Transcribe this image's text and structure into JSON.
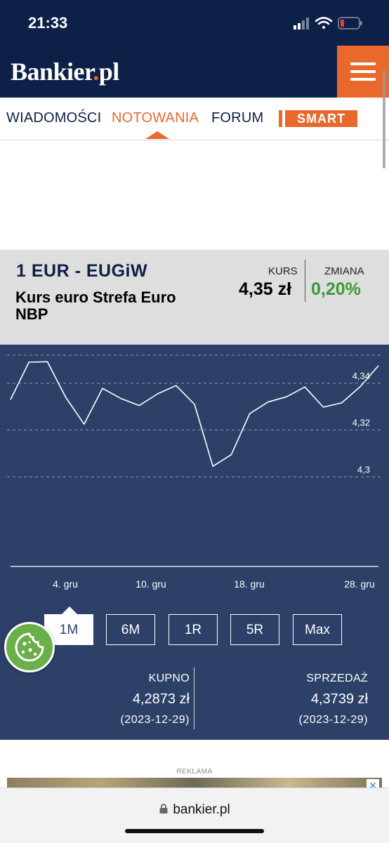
{
  "status": {
    "time": "21:33"
  },
  "header": {
    "logo_main": "Bankier",
    "logo_dot": ".",
    "logo_tld": "pl"
  },
  "nav": {
    "items": [
      "WIADOMOŚCI",
      "NOTOWANIA",
      "FORUM"
    ],
    "smart_label": "SMART"
  },
  "quote": {
    "pair": "1 EUR - EUGiW",
    "description": "Kurs euro Strefa Euro NBP",
    "kurs_label": "KURS",
    "kurs_value": "4,35 zł",
    "zmiana_label": "ZMIANA",
    "zmiana_value": "0,20%"
  },
  "colors": {
    "navy": "#0d2048",
    "accent": "#e9692c",
    "chart_bg": "#2c4068",
    "positive": "#3a9a3a"
  },
  "chart_data": {
    "type": "line",
    "y_ticks": [
      "4,34",
      "4,32",
      "4,3"
    ],
    "x_ticks": [
      "4. gru",
      "10. gru",
      "18. gru",
      "28. gru"
    ],
    "ylim": [
      4.28,
      4.352
    ],
    "series": [
      {
        "values": [
          4.333,
          4.349,
          4.3492,
          4.334,
          4.3225,
          4.3378,
          4.3335,
          4.3305,
          4.3355,
          4.339,
          4.331,
          4.3045,
          4.3095,
          4.327,
          4.332,
          4.3342,
          4.3384,
          4.3298,
          4.3316,
          4.3385,
          4.3475
        ]
      }
    ],
    "grid": true
  },
  "ranges": [
    "1M",
    "6M",
    "1R",
    "5R",
    "Max"
  ],
  "active_range": "1M",
  "stats": {
    "kupno_label": "KUPNO",
    "kupno_value": "4,2873 zł",
    "kupno_date": "(2023-12-29)",
    "sprzedaz_label": "SPRZEDAŻ",
    "sprzedaz_value": "4,3739 zł",
    "sprzedaz_date": "(2023-12-29)"
  },
  "ad": {
    "label": "REKLAMA"
  },
  "browser": {
    "url": "bankier.pl"
  }
}
